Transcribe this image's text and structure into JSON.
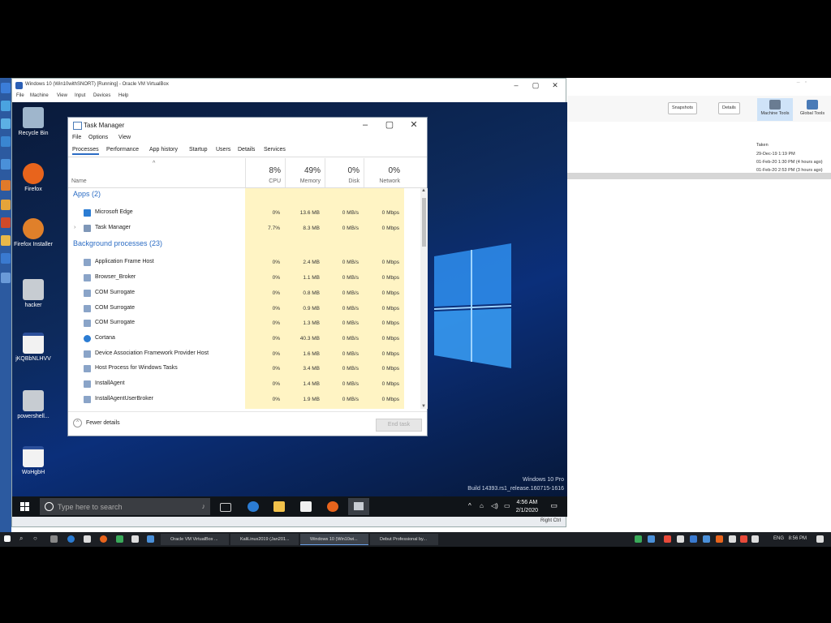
{
  "vbox": {
    "title": "Windows 10 (Win10withSNORT) [Running] - Oracle VM VirtualBox",
    "menu": [
      "File",
      "Machine",
      "View",
      "Input",
      "Devices",
      "Help"
    ],
    "status_right": "Right Ctrl"
  },
  "desktop": {
    "icons": [
      "Recycle Bin",
      "Firefox",
      "Firefox Installer",
      "hacker",
      "jKQBbNLHVV",
      "powershell...",
      "WoHgbH"
    ],
    "watermark_line1": "Windows 10 Pro",
    "watermark_line2": "Build 14393.rs1_release.160715-1616"
  },
  "guest_taskbar": {
    "search_placeholder": "Type here to search",
    "time": "4:56 AM",
    "date": "2/1/2020"
  },
  "task_manager": {
    "title": "Task Manager",
    "menu": [
      "File",
      "Options",
      "View"
    ],
    "tabs": [
      "Processes",
      "Performance",
      "App history",
      "Startup",
      "Users",
      "Details",
      "Services"
    ],
    "active_tab": "Processes",
    "columns": {
      "name": "Name",
      "cpu": {
        "pct": "8%",
        "label": "CPU"
      },
      "memory": {
        "pct": "49%",
        "label": "Memory"
      },
      "disk": {
        "pct": "0%",
        "label": "Disk"
      },
      "network": {
        "pct": "0%",
        "label": "Network"
      }
    },
    "groups": [
      {
        "label": "Apps (2)",
        "rows": [
          {
            "name": "Microsoft Edge",
            "icon": "edge-icon",
            "cpu": "0%",
            "memory": "13.6 MB",
            "disk": "0 MB/s",
            "network": "0 Mbps"
          },
          {
            "name": "Task Manager",
            "icon": "task-manager-icon",
            "cpu": "7.7%",
            "memory": "8.3 MB",
            "disk": "0 MB/s",
            "network": "0 Mbps"
          }
        ]
      },
      {
        "label": "Background processes (23)",
        "rows": [
          {
            "name": "Application Frame Host",
            "icon": "process-icon",
            "cpu": "0%",
            "memory": "2.4 MB",
            "disk": "0 MB/s",
            "network": "0 Mbps"
          },
          {
            "name": "Browser_Broker",
            "icon": "process-icon",
            "cpu": "0%",
            "memory": "1.1 MB",
            "disk": "0 MB/s",
            "network": "0 Mbps"
          },
          {
            "name": "COM Surrogate",
            "icon": "process-icon",
            "cpu": "0%",
            "memory": "0.8 MB",
            "disk": "0 MB/s",
            "network": "0 Mbps"
          },
          {
            "name": "COM Surrogate",
            "icon": "process-icon",
            "cpu": "0%",
            "memory": "0.9 MB",
            "disk": "0 MB/s",
            "network": "0 Mbps"
          },
          {
            "name": "COM Surrogate",
            "icon": "process-icon",
            "cpu": "0%",
            "memory": "1.3 MB",
            "disk": "0 MB/s",
            "network": "0 Mbps"
          },
          {
            "name": "Cortana",
            "icon": "cortana-icon",
            "cpu": "0%",
            "memory": "40.3 MB",
            "disk": "0 MB/s",
            "network": "0 Mbps"
          },
          {
            "name": "Device Association Framework Provider Host",
            "icon": "process-icon",
            "cpu": "0%",
            "memory": "1.6 MB",
            "disk": "0 MB/s",
            "network": "0 Mbps"
          },
          {
            "name": "Host Process for Windows Tasks",
            "icon": "process-icon",
            "cpu": "0%",
            "memory": "3.4 MB",
            "disk": "0 MB/s",
            "network": "0 Mbps"
          },
          {
            "name": "InstallAgent",
            "icon": "process-icon",
            "cpu": "0%",
            "memory": "1.4 MB",
            "disk": "0 MB/s",
            "network": "0 Mbps"
          },
          {
            "name": "InstallAgentUserBroker",
            "icon": "process-icon",
            "cpu": "0%",
            "memory": "1.9 MB",
            "disk": "0 MB/s",
            "network": "0 Mbps"
          }
        ]
      }
    ],
    "fewer_details": "Fewer details",
    "end_task": "End task"
  },
  "manager": {
    "buttons": [
      "Snapshots",
      "Details"
    ],
    "tools": [
      "Machine Tools",
      "Global Tools"
    ],
    "list_header": "Taken",
    "list": [
      "29-Dec-19 1:19 PM",
      "01-Feb-20 1:30 PM (4 hours ago)",
      "01-Feb-20 2:53 PM (3 hours ago)"
    ]
  },
  "host_taskbar": {
    "windows": [
      "Oracle VM VirtualBox ...",
      "KaliLinux2019 (Jan201...",
      "Windows 10 (Win10wi...",
      "Debut Professional by..."
    ],
    "active_index": 2,
    "lang": "ENG",
    "time": "8:56 PM"
  }
}
